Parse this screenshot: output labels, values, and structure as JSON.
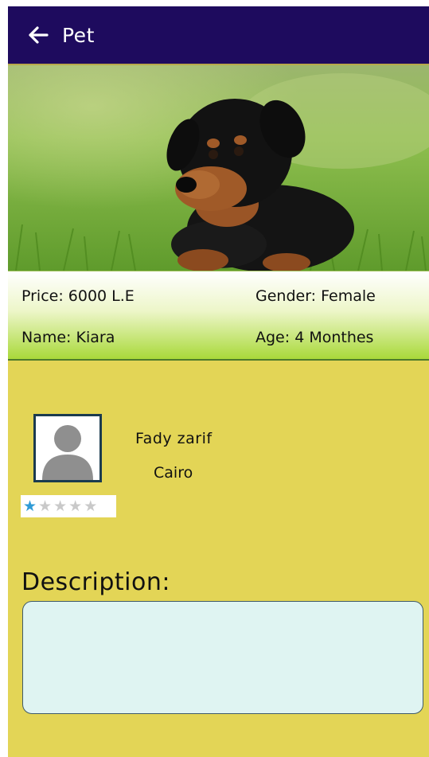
{
  "header": {
    "title": "Pet",
    "back_icon": "arrow-left-icon"
  },
  "pet": {
    "photo_alt": "rottweiler puppy lying on grass",
    "price_text": "Price: 6000 L.E",
    "gender_text": "Gender: Female",
    "name_text": "Name: Kiara",
    "age_text": "Age: 4 Monthes"
  },
  "owner": {
    "name": "Fady  zarif",
    "city": "Cairo",
    "avatar_icon": "user-avatar-icon",
    "rating": 1,
    "rating_max": 5
  },
  "description": {
    "label": "Description:",
    "value": ""
  },
  "colors": {
    "appbar": "#1e0b5e",
    "background": "#e3d556",
    "star_active": "#2f9bd6",
    "description_box": "#dff4f2"
  }
}
